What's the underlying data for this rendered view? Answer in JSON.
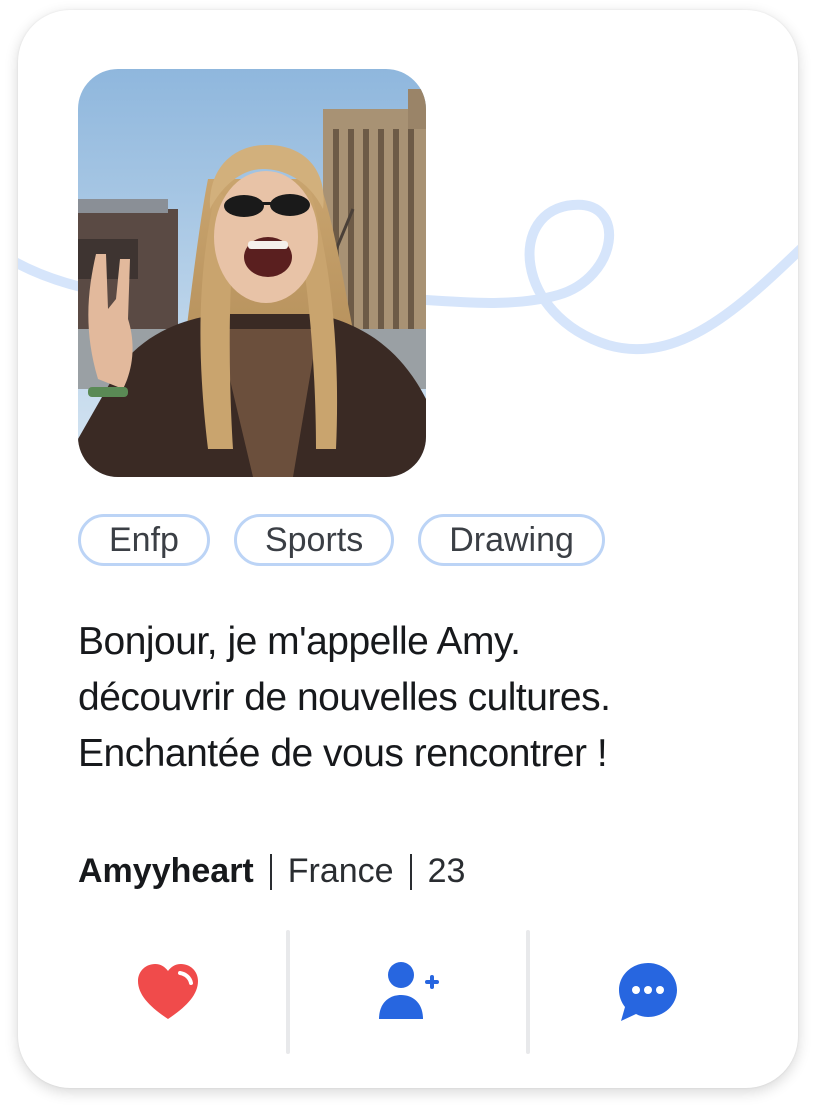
{
  "profile": {
    "photo_icon": "profile-photo",
    "tags": [
      "Enfp",
      "Sports",
      "Drawing"
    ],
    "bio": [
      "Bonjour, je m'appelle Amy.",
      "découvrir de nouvelles cultures.",
      "Enchantée de vous rencontrer !"
    ],
    "username": "Amyyheart",
    "country": "France",
    "age": "23"
  },
  "actions": {
    "like_icon": "heart-icon",
    "add_friend_icon": "add-user-icon",
    "message_icon": "chat-bubble-icon"
  },
  "colors": {
    "tag_border": "#bcd4f6",
    "squiggle": "#d6e5fb",
    "heart": "#f04b4b",
    "accent_blue": "#2766e0"
  }
}
